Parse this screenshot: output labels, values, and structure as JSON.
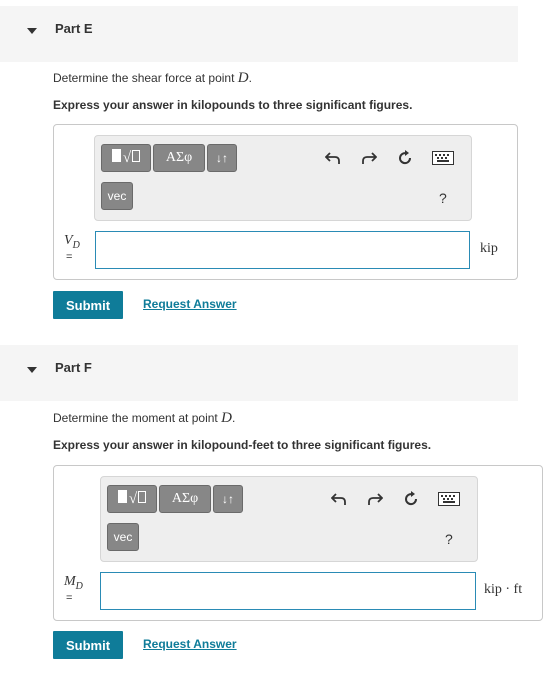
{
  "part_e": {
    "title": "Part E",
    "prompt_text": "Determine the shear force at point",
    "prompt_point": "D",
    "prompt_end": ".",
    "instruction": "Express your answer in kilopounds to three significant figures.",
    "toolbar": {
      "greek_label": "ΑΣφ",
      "arrows_label": "↓↑",
      "vec_label": "vec",
      "help_label": "?"
    },
    "variable": "V",
    "variable_sub": "D",
    "equals": "=",
    "input_value": "",
    "unit": "kip",
    "submit_label": "Submit",
    "request_label": "Request Answer"
  },
  "part_f": {
    "title": "Part F",
    "prompt_text": "Determine the moment at point",
    "prompt_point": "D",
    "prompt_end": ".",
    "instruction": "Express your answer in kilopound-feet to three significant figures.",
    "toolbar": {
      "greek_label": "ΑΣφ",
      "arrows_label": "↓↑",
      "vec_label": "vec",
      "help_label": "?"
    },
    "variable": "M",
    "variable_sub": "D",
    "equals": "=",
    "input_value": "",
    "unit": "kip · ft",
    "submit_label": "Submit",
    "request_label": "Request Answer"
  },
  "icons": {
    "caret": "caret-down-icon",
    "undo": "undo-icon",
    "redo": "redo-icon",
    "reset": "reset-icon",
    "keyboard": "keyboard-icon",
    "templates": "templates-icon"
  },
  "colors": {
    "accent": "#0f7c99",
    "header_bg": "#f5f5f5",
    "toolbar_bg": "#eeeeee",
    "button_gray": "#878787",
    "input_border": "#2a8bb5"
  }
}
